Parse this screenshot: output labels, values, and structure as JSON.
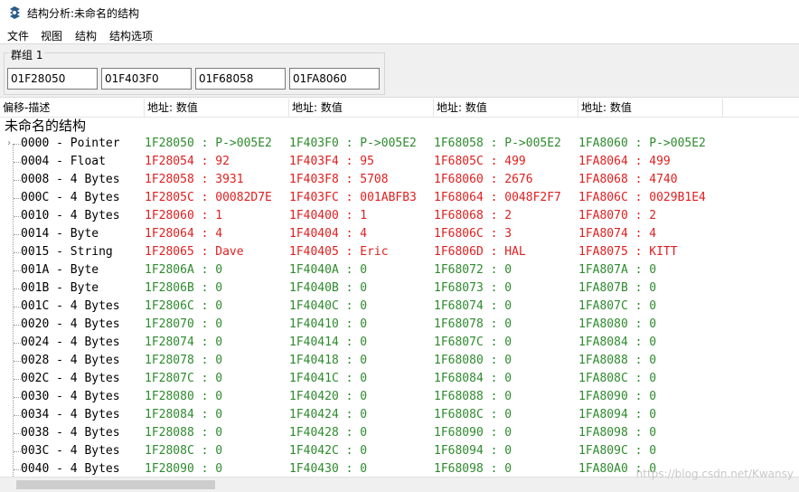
{
  "window": {
    "title": "结构分析:未命名的结构",
    "app_icon": "cheat-engine-icon"
  },
  "menu": [
    "文件",
    "视图",
    "结构",
    "结构选项"
  ],
  "group": {
    "label": "群组 1",
    "addresses": [
      "01F28050",
      "01F403F0",
      "01F68058",
      "01FA8060"
    ]
  },
  "columns": {
    "offset_desc": "偏移-描述",
    "value": "地址: 数值"
  },
  "structure_name": "未命名的结构",
  "colors": {
    "unchanged": "#2e8b2e",
    "differs": "#e02020"
  },
  "rows": [
    {
      "desc": "0000 - Pointer",
      "expandable": true,
      "diff": false,
      "cells": [
        "1F28050 : P->005E2",
        "1F403F0 : P->005E2",
        "1F68058 : P->005E2",
        "1FA8060 : P->005E2"
      ]
    },
    {
      "desc": "0004 - Float",
      "diff": true,
      "cells": [
        "1F28054 : 92",
        "1F403F4 : 95",
        "1F6805C : 499",
        "1FA8064 : 499"
      ]
    },
    {
      "desc": "0008 - 4 Bytes",
      "diff": true,
      "cells": [
        "1F28058 : 3931",
        "1F403F8 : 5708",
        "1F68060 : 2676",
        "1FA8068 : 4740"
      ]
    },
    {
      "desc": "000C - 4 Bytes",
      "diff": true,
      "cells": [
        "1F2805C : 00082D7E",
        "1F403FC : 001ABFB3",
        "1F68064 : 0048F2F7",
        "1FA806C : 0029B1E4"
      ]
    },
    {
      "desc": "0010 - 4 Bytes",
      "diff": true,
      "cells": [
        "1F28060 : 1",
        "1F40400 : 1",
        "1F68068 : 2",
        "1FA8070 : 2"
      ]
    },
    {
      "desc": "0014 - Byte",
      "diff": true,
      "cells": [
        "1F28064 : 4",
        "1F40404 : 4",
        "1F6806C : 3",
        "1FA8074 : 4"
      ]
    },
    {
      "desc": "0015 - String",
      "diff": true,
      "cells": [
        "1F28065 : Dave",
        "1F40405 : Eric",
        "1F6806D : HAL",
        "1FA8075 : KITT"
      ]
    },
    {
      "desc": "001A - Byte",
      "diff": false,
      "cells": [
        "1F2806A : 0",
        "1F4040A : 0",
        "1F68072 : 0",
        "1FA807A : 0"
      ]
    },
    {
      "desc": "001B - Byte",
      "diff": false,
      "cells": [
        "1F2806B : 0",
        "1F4040B : 0",
        "1F68073 : 0",
        "1FA807B : 0"
      ]
    },
    {
      "desc": "001C - 4 Bytes",
      "diff": false,
      "cells": [
        "1F2806C : 0",
        "1F4040C : 0",
        "1F68074 : 0",
        "1FA807C : 0"
      ]
    },
    {
      "desc": "0020 - 4 Bytes",
      "diff": false,
      "cells": [
        "1F28070 : 0",
        "1F40410 : 0",
        "1F68078 : 0",
        "1FA8080 : 0"
      ]
    },
    {
      "desc": "0024 - 4 Bytes",
      "diff": false,
      "cells": [
        "1F28074 : 0",
        "1F40414 : 0",
        "1F6807C : 0",
        "1FA8084 : 0"
      ]
    },
    {
      "desc": "0028 - 4 Bytes",
      "diff": false,
      "cells": [
        "1F28078 : 0",
        "1F40418 : 0",
        "1F68080 : 0",
        "1FA8088 : 0"
      ]
    },
    {
      "desc": "002C - 4 Bytes",
      "diff": false,
      "cells": [
        "1F2807C : 0",
        "1F4041C : 0",
        "1F68084 : 0",
        "1FA808C : 0"
      ]
    },
    {
      "desc": "0030 - 4 Bytes",
      "diff": false,
      "cells": [
        "1F28080 : 0",
        "1F40420 : 0",
        "1F68088 : 0",
        "1FA8090 : 0"
      ]
    },
    {
      "desc": "0034 - 4 Bytes",
      "diff": false,
      "cells": [
        "1F28084 : 0",
        "1F40424 : 0",
        "1F6808C : 0",
        "1FA8094 : 0"
      ]
    },
    {
      "desc": "0038 - 4 Bytes",
      "diff": false,
      "cells": [
        "1F28088 : 0",
        "1F40428 : 0",
        "1F68090 : 0",
        "1FA8098 : 0"
      ]
    },
    {
      "desc": "003C - 4 Bytes",
      "diff": false,
      "cells": [
        "1F2808C : 0",
        "1F4042C : 0",
        "1F68094 : 0",
        "1FA809C : 0"
      ]
    },
    {
      "desc": "0040 - 4 Bytes",
      "diff": false,
      "cells": [
        "1F28090 : 0",
        "1F40430 : 0",
        "1F68098 : 0",
        "1FA80A0 : 0"
      ]
    }
  ],
  "watermark": "https://blog.csdn.net/Kwansy"
}
